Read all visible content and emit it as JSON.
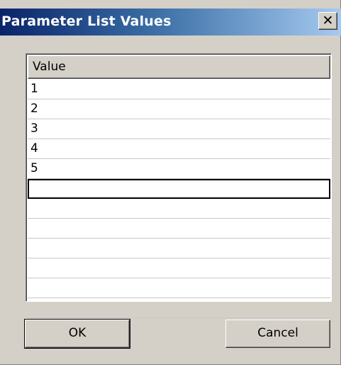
{
  "window": {
    "title": "Parameter List Values",
    "close_glyph": "✕",
    "close_icon": "close-icon"
  },
  "list": {
    "column_header": "Value",
    "rows": [
      "1",
      "2",
      "3",
      "4",
      "5",
      "",
      "",
      "",
      "",
      "",
      "",
      ""
    ],
    "editing_row_index": 5
  },
  "buttons": {
    "ok_label": "OK",
    "cancel_label": "Cancel"
  },
  "colors": {
    "titlebar_start": "#0a246a",
    "titlebar_end": "#a6caf0",
    "dialog_face": "#d4d0c8"
  }
}
